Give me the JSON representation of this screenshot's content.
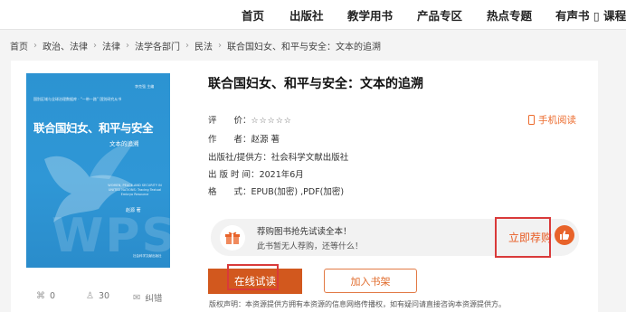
{
  "nav": {
    "items": [
      "首页",
      "出版社",
      "教学用书",
      "产品专区",
      "热点专题",
      "有声书 ▯ 课程"
    ]
  },
  "breadcrumb": [
    "首页",
    "政治、法律",
    "法律",
    "法学各部门",
    "民法",
    "联合国妇女、和平与安全：文本的追溯"
  ],
  "book": {
    "title": "联合国妇女、和平与安全：文本的追溯",
    "rating_label": "评　　价：",
    "rating_stars": "☆☆☆☆☆",
    "author_label": "作　　者：",
    "author": "赵源 著",
    "publisher_label": "出版社/提供方：",
    "publisher": "社会科学文献出版社",
    "date_label": "出 版 时 间：",
    "date": "2021年6月",
    "format_label": "格　　式：",
    "format": "EPUB(加密) ,PDF(加密)",
    "mobile_read": "手机阅读"
  },
  "cover": {
    "series": "国别区域与全球治理数据库 · “一带一路” 国别研究从书",
    "editor": "李克强 主编",
    "title": "联合国妇女、和平与安全",
    "subtitle": "文本的追溯",
    "english": "WOMEN, PEACE AND SECURITY IN UNITED NATIONS: Tracing Textual Embryo Resource",
    "author": "赵源 著",
    "publisher": "社会科学文献出版社"
  },
  "stats": {
    "shares": "0",
    "readers": "30",
    "errata": "纠错"
  },
  "preorder": {
    "line1": "荐购图书抢先试读全本！",
    "line2": "此书暂无人荐购，还等什么！",
    "button": "立即荐购"
  },
  "actions": {
    "read_online": "在线试读",
    "add_shelf": "加入书架"
  },
  "copyright": "版权声明：本资源提供方拥有本资源的信息网络传播权，如有疑问请直接咨询本资源提供方。",
  "colors": {
    "accent": "#d2581e",
    "highlight_box": "#d93a3a",
    "cover_blue": "#2f97d6"
  }
}
